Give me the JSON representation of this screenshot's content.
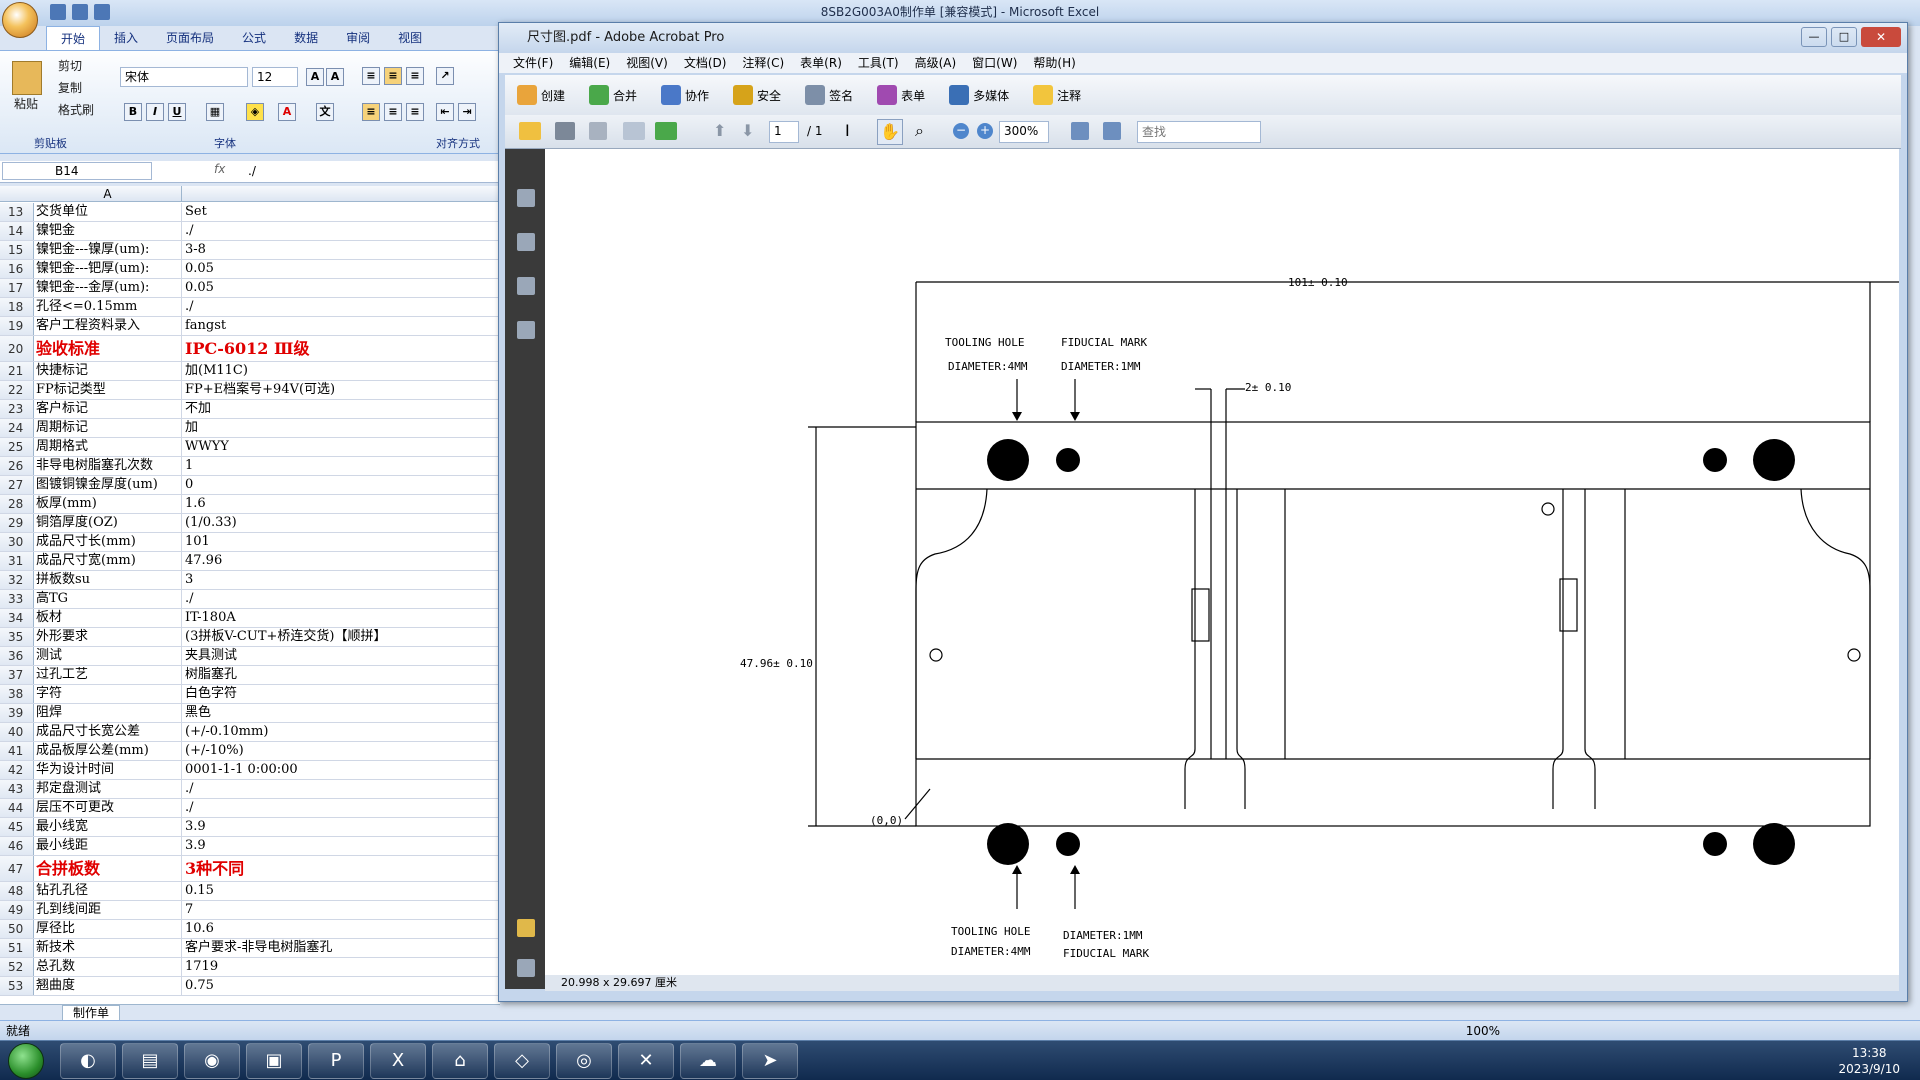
{
  "excel": {
    "title": "8SB2G003A0制作单  [兼容模式] - Microsoft Excel",
    "tabs": [
      "开始",
      "插入",
      "页面布局",
      "公式",
      "数据",
      "审阅",
      "视图"
    ],
    "clipboard": {
      "paste": "粘贴",
      "cut": "剪切",
      "copy": "复制",
      "format_painter": "格式刷",
      "label": "剪贴板"
    },
    "font": {
      "name": "宋体",
      "size": "12",
      "label": "字体"
    },
    "align_label": "对齐方式",
    "name_box": "B14",
    "formula": "./",
    "col_header": "A",
    "rows": [
      {
        "n": "13",
        "a": "交货单位",
        "b": "Set"
      },
      {
        "n": "14",
        "a": "镍钯金",
        "b": "./"
      },
      {
        "n": "15",
        "a": "镍钯金---镍厚(um):",
        "b": "3-8"
      },
      {
        "n": "16",
        "a": "镍钯金---钯厚(um):",
        "b": "0.05"
      },
      {
        "n": "17",
        "a": "镍钯金---金厚(um):",
        "b": "0.05"
      },
      {
        "n": "18",
        "a": "孔径<=0.15mm",
        "b": "./"
      },
      {
        "n": "19",
        "a": "客户工程资料录入",
        "b": "fangst"
      },
      {
        "n": "20",
        "a": "验收标准",
        "b": "IPC-6012 Ⅲ级",
        "big": true
      },
      {
        "n": "21",
        "a": "快捷标记",
        "b": "加(M11C)"
      },
      {
        "n": "22",
        "a": "FP标记类型",
        "b": "FP+E档案号+94V(可选)"
      },
      {
        "n": "23",
        "a": "客户标记",
        "b": "不加"
      },
      {
        "n": "24",
        "a": "周期标记",
        "b": "加"
      },
      {
        "n": "25",
        "a": "周期格式",
        "b": "WWYY"
      },
      {
        "n": "26",
        "a": "非导电树脂塞孔次数",
        "b": "1"
      },
      {
        "n": "27",
        "a": "图镀铜镍金厚度(um)",
        "b": "0"
      },
      {
        "n": "28",
        "a": "板厚(mm)",
        "b": "1.6"
      },
      {
        "n": "29",
        "a": "铜箔厚度(OZ)",
        "b": " (1/0.33)"
      },
      {
        "n": "30",
        "a": "成品尺寸长(mm)",
        "b": "101"
      },
      {
        "n": "31",
        "a": "成品尺寸宽(mm)",
        "b": "47.96"
      },
      {
        "n": "32",
        "a": "拼板数su",
        "b": "3"
      },
      {
        "n": "33",
        "a": "高TG",
        "b": "./"
      },
      {
        "n": "34",
        "a": "板材",
        "b": "IT-180A"
      },
      {
        "n": "35",
        "a": "外形要求",
        "b": "(3拼板V-CUT+桥连交货)【顺拼】"
      },
      {
        "n": "36",
        "a": "测试",
        "b": "夹具测试"
      },
      {
        "n": "37",
        "a": "过孔工艺",
        "b": "树脂塞孔"
      },
      {
        "n": "38",
        "a": "字符",
        "b": "白色字符"
      },
      {
        "n": "39",
        "a": "阻焊",
        "b": "黑色"
      },
      {
        "n": "40",
        "a": "成品尺寸长宽公差",
        "b": "(+/-0.10mm)"
      },
      {
        "n": "41",
        "a": "成品板厚公差(mm)",
        "b": "(+/-10%)"
      },
      {
        "n": "42",
        "a": "华为设计时间",
        "b": "0001-1-1 0:00:00"
      },
      {
        "n": "43",
        "a": "邦定盘测试",
        "b": "./"
      },
      {
        "n": "44",
        "a": "层压不可更改",
        "b": "./"
      },
      {
        "n": "45",
        "a": "最小线宽",
        "b": "3.9"
      },
      {
        "n": "46",
        "a": "最小线距",
        "b": "3.9"
      },
      {
        "n": "47",
        "a": "合拼板数",
        "b": "3种不同",
        "big": true
      },
      {
        "n": "48",
        "a": "钻孔孔径",
        "b": "0.15"
      },
      {
        "n": "49",
        "a": "孔到线间距",
        "b": "7"
      },
      {
        "n": "50",
        "a": "厚径比",
        "b": "10.6"
      },
      {
        "n": "51",
        "a": "新技术",
        "b": "客户要求-非导电树脂塞孔"
      },
      {
        "n": "52",
        "a": "总孔数",
        "b": "1719"
      },
      {
        "n": "53",
        "a": "翘曲度",
        "b": "0.75"
      }
    ],
    "sheet_tab": "制作单",
    "status": "就绪",
    "zoom": "100%"
  },
  "acrobat": {
    "title": "尺寸图.pdf - Adobe Acrobat Pro",
    "menu": [
      "文件(F)",
      "编辑(E)",
      "视图(V)",
      "文档(D)",
      "注释(C)",
      "表单(R)",
      "工具(T)",
      "高级(A)",
      "窗口(W)",
      "帮助(H)"
    ],
    "toolbar": [
      "创建",
      "合并",
      "协作",
      "安全",
      "签名",
      "表单",
      "多媒体",
      "注释"
    ],
    "page_current": "1",
    "page_total": "/ 1",
    "zoom": "300%",
    "find_placeholder": "查找",
    "page_size": "20.998 x 29.697 厘米",
    "drawing": {
      "dim_width": "101± 0.10",
      "dim_height": "47.96± 0.10",
      "dim_bridge": "2± 0.10",
      "tooling_top": "TOOLING HOLE",
      "tooling_top_d": "DIAMETER:4MM",
      "fiducial_top": "FIDUCIAL MARK",
      "fiducial_top_d": "DIAMETER:1MM",
      "tooling_bot": "TOOLING HOLE",
      "tooling_bot_d": "DIAMETER:4MM",
      "fiducial_bot_d": "DIAMETER:1MM",
      "fiducial_bot": "FIDUCIAL MARK",
      "origin": "(0,0)"
    }
  },
  "taskbar": {
    "time": "13:38",
    "date": "2023/9/10"
  }
}
